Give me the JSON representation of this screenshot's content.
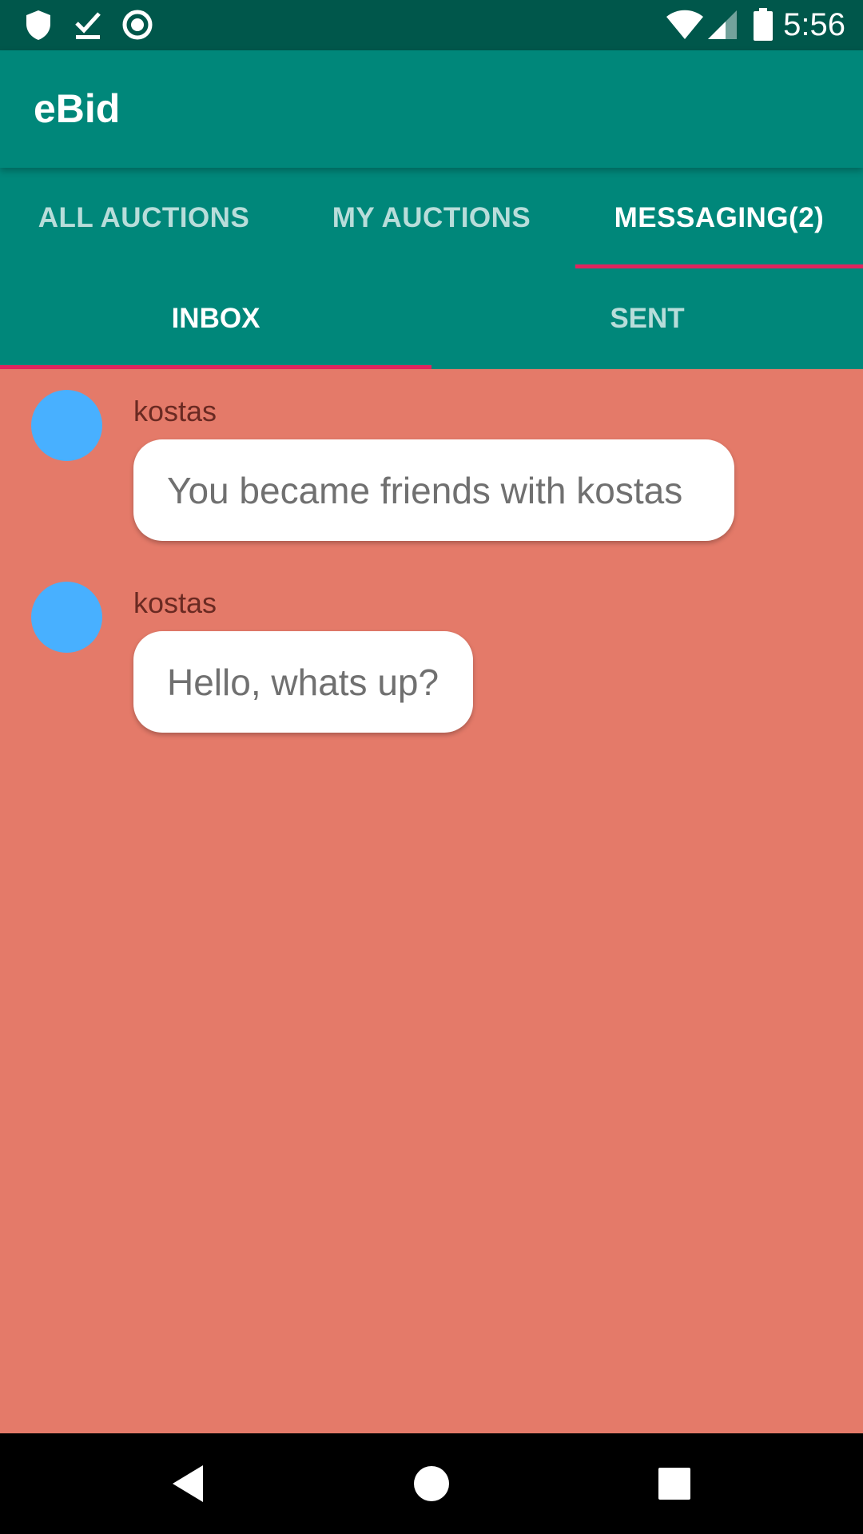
{
  "status_bar": {
    "time": "5:56",
    "icons": [
      "shield-icon",
      "download-done-icon",
      "record-icon",
      "wifi-icon",
      "signal-icon",
      "battery-icon"
    ]
  },
  "app_bar": {
    "title": "eBid"
  },
  "main_tabs": [
    {
      "label": "ALL AUCTIONS",
      "active": false
    },
    {
      "label": "MY AUCTIONS",
      "active": false
    },
    {
      "label": "MESSAGING(2)",
      "active": true
    }
  ],
  "sub_tabs": [
    {
      "label": "INBOX",
      "active": true
    },
    {
      "label": "SENT",
      "active": false
    }
  ],
  "messages": [
    {
      "sender": "kostas",
      "text": "You became friends with kostas"
    },
    {
      "sender": "kostas",
      "text": "Hello, whats up?"
    }
  ],
  "colors": {
    "status_bar": "#00574B",
    "primary": "#00877A",
    "accent_indicator": "#E0245E",
    "background": "#E47A69",
    "avatar": "#48B0FF"
  },
  "nav_bar": {
    "icons": [
      "back-icon",
      "home-icon",
      "recents-icon"
    ]
  }
}
